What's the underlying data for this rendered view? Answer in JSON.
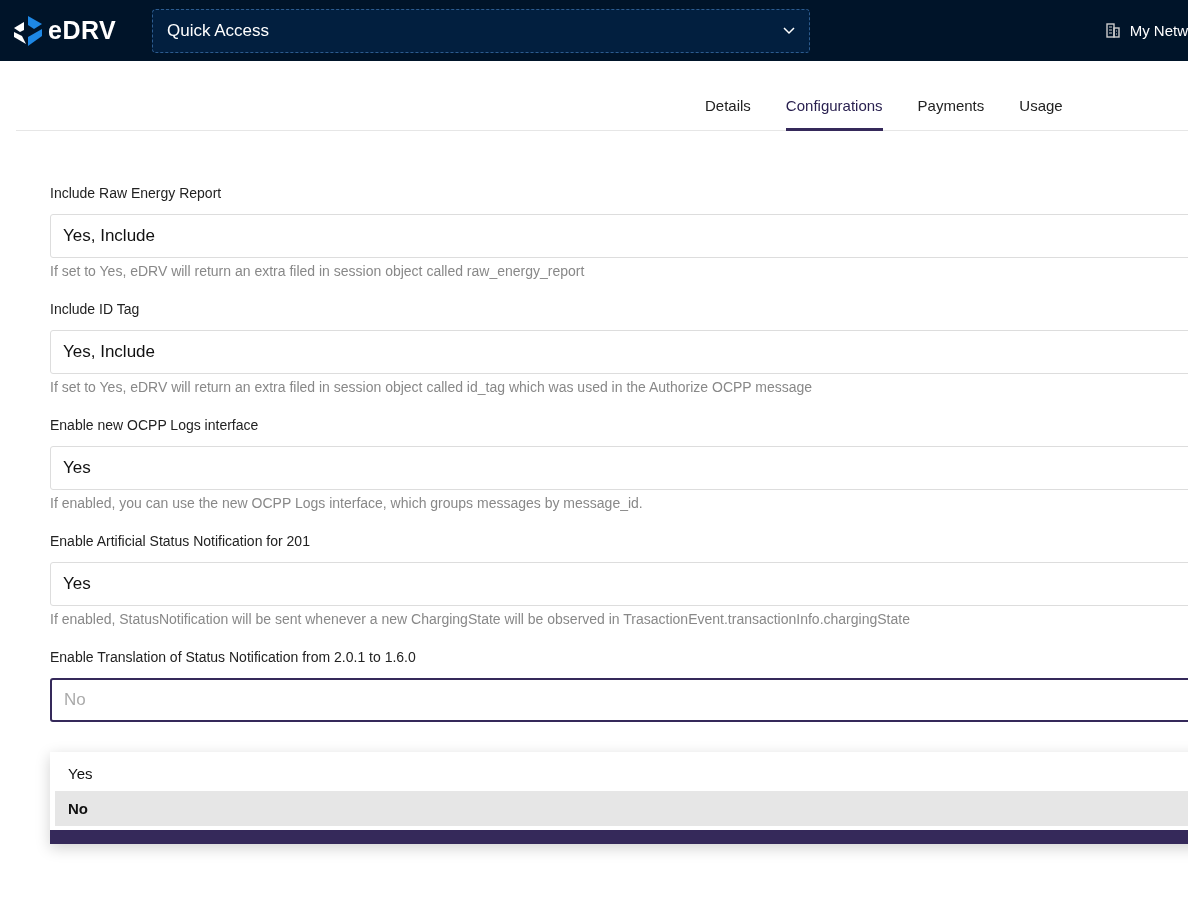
{
  "header": {
    "brand": "eDRV",
    "quick_access": {
      "label": "Quick Access"
    },
    "network": {
      "label": "My Netw"
    }
  },
  "tabs": [
    {
      "label": "Details",
      "selected": false
    },
    {
      "label": "Configurations",
      "selected": true
    },
    {
      "label": "Payments",
      "selected": false
    },
    {
      "label": "Usage",
      "selected": false
    }
  ],
  "settings": [
    {
      "label": "Include Raw Energy Report",
      "value": "Yes, Include",
      "hint": "If set to Yes, eDRV will return an extra filed in session object called raw_energy_report",
      "open": false
    },
    {
      "label": "Include ID Tag",
      "value": "Yes, Include",
      "hint": "If set to Yes, eDRV will return an extra filed in session object called id_tag which was used in the Authorize OCPP message",
      "open": false
    },
    {
      "label": "Enable new OCPP Logs interface",
      "value": "Yes",
      "hint": "If enabled, you can use the new OCPP Logs interface, which groups messages by message_id.",
      "open": false
    },
    {
      "label": "Enable Artificial Status Notification for 201",
      "value": "Yes",
      "hint": "If enabled, StatusNotification will be sent whenever a new ChargingState will be observed in TrasactionEvent.transactionInfo.chargingState",
      "open": false
    },
    {
      "label": "Enable Translation of Status Notification from 2.0.1 to 1.6.0",
      "placeholder": "No",
      "open": true,
      "options": [
        {
          "label": "Yes",
          "selected": false
        },
        {
          "label": "No",
          "selected": true
        }
      ]
    }
  ]
}
